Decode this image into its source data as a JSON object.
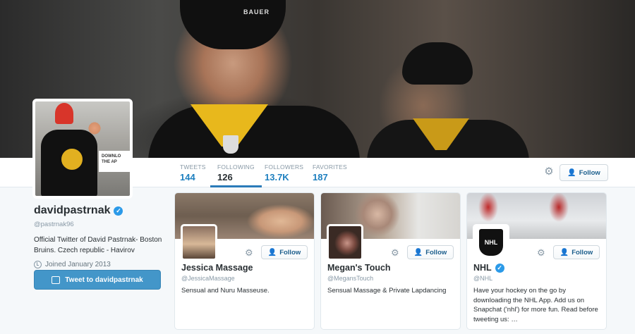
{
  "stats": [
    {
      "label": "TWEETS",
      "value": "144"
    },
    {
      "label": "FOLLOWING",
      "value": "126"
    },
    {
      "label": "FOLLOWERS",
      "value": "13.7K"
    },
    {
      "label": "FAVORITES",
      "value": "187"
    }
  ],
  "active_tab": "FOLLOWING",
  "header": {
    "helmet_brand": "BAUER",
    "follow_label": "Follow"
  },
  "profile": {
    "name": "davidpastrnak",
    "handle": "@pastrnak96",
    "bio": "Official Twitter of David Pastrnak- Boston Bruins. Czech republic - Havirov",
    "joined": "Joined January 2013",
    "tweet_button": "Tweet to davidpastrnak",
    "verified": true,
    "avatar_sign": "DOWNLO THE AP"
  },
  "cards": [
    {
      "name": "Jessica Massage",
      "handle": "@JessicaMassage",
      "bio": "Sensual and Nuru Masseuse.",
      "verified": false,
      "follow_label": "Follow"
    },
    {
      "name": "Megan's Touch",
      "handle": "@MegansTouch",
      "bio": "Sensual Massage & Private Lapdancing",
      "verified": false,
      "follow_label": "Follow"
    },
    {
      "name": "NHL",
      "handle": "@NHL",
      "bio": "Have your hockey on the go by downloading the NHL App. Add us on Snapchat ('nhl') for more fun. Read before tweeting us: …",
      "verified": true,
      "follow_label": "Follow",
      "logo_text": "NHL"
    }
  ],
  "colors": {
    "link_blue": "#1d7fbf",
    "tweet_button": "#4396c9",
    "verified": "#2b9ae8",
    "bruins_gold": "#e8b81c"
  }
}
